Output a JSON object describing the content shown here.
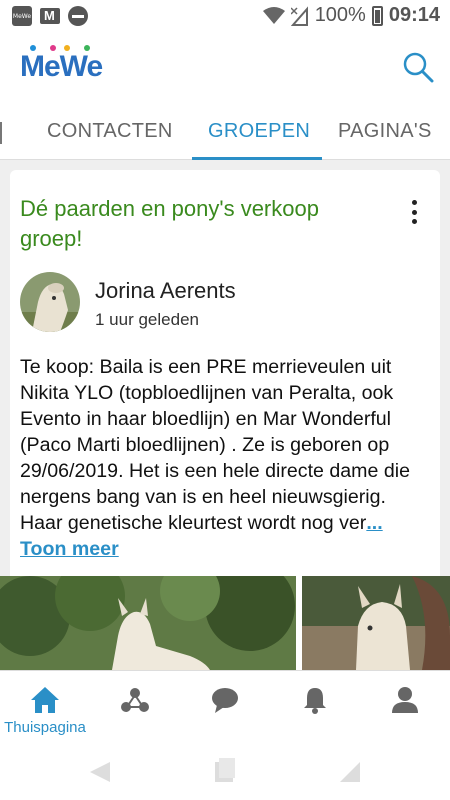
{
  "status_bar": {
    "app_icon_text": "MeWe",
    "battery": "100%",
    "time": "09:14"
  },
  "header": {
    "logo": "MeWe"
  },
  "tabs": [
    {
      "label": "CONTACTEN",
      "active": false
    },
    {
      "label": "GROEPEN",
      "active": true
    },
    {
      "label": "PAGINA'S",
      "active": false
    }
  ],
  "post": {
    "group_title": "Dé paarden en pony's verkoop groep!",
    "author": "Jorina Aerents",
    "time": "1 uur geleden",
    "text": "Te koop: Baila is een PRE merrieveulen uit Nikita YLO (topbloedlijnen van Peralta, ook Evento in haar bloedlijn) en Mar Wonderful (Paco Marti bloedlijnen) . Ze is geboren op 29/06/2019. Het is een hele directe dame die nergens bang van is en heel nieuwsgierig. Haar genetische kleurtest wordt nog ver",
    "more_label": "... Toon meer"
  },
  "bottom_nav": [
    {
      "icon": "home-icon",
      "label": "Thuispagina",
      "active": true
    },
    {
      "icon": "groups-icon",
      "label": "",
      "active": false
    },
    {
      "icon": "chat-icon",
      "label": "",
      "active": false
    },
    {
      "icon": "bell-icon",
      "label": "",
      "active": false
    },
    {
      "icon": "profile-icon",
      "label": "",
      "active": false
    }
  ],
  "colors": {
    "accent": "#2a8fc7",
    "group_title": "#3a8a1e",
    "logo": "#2a6fbf"
  }
}
